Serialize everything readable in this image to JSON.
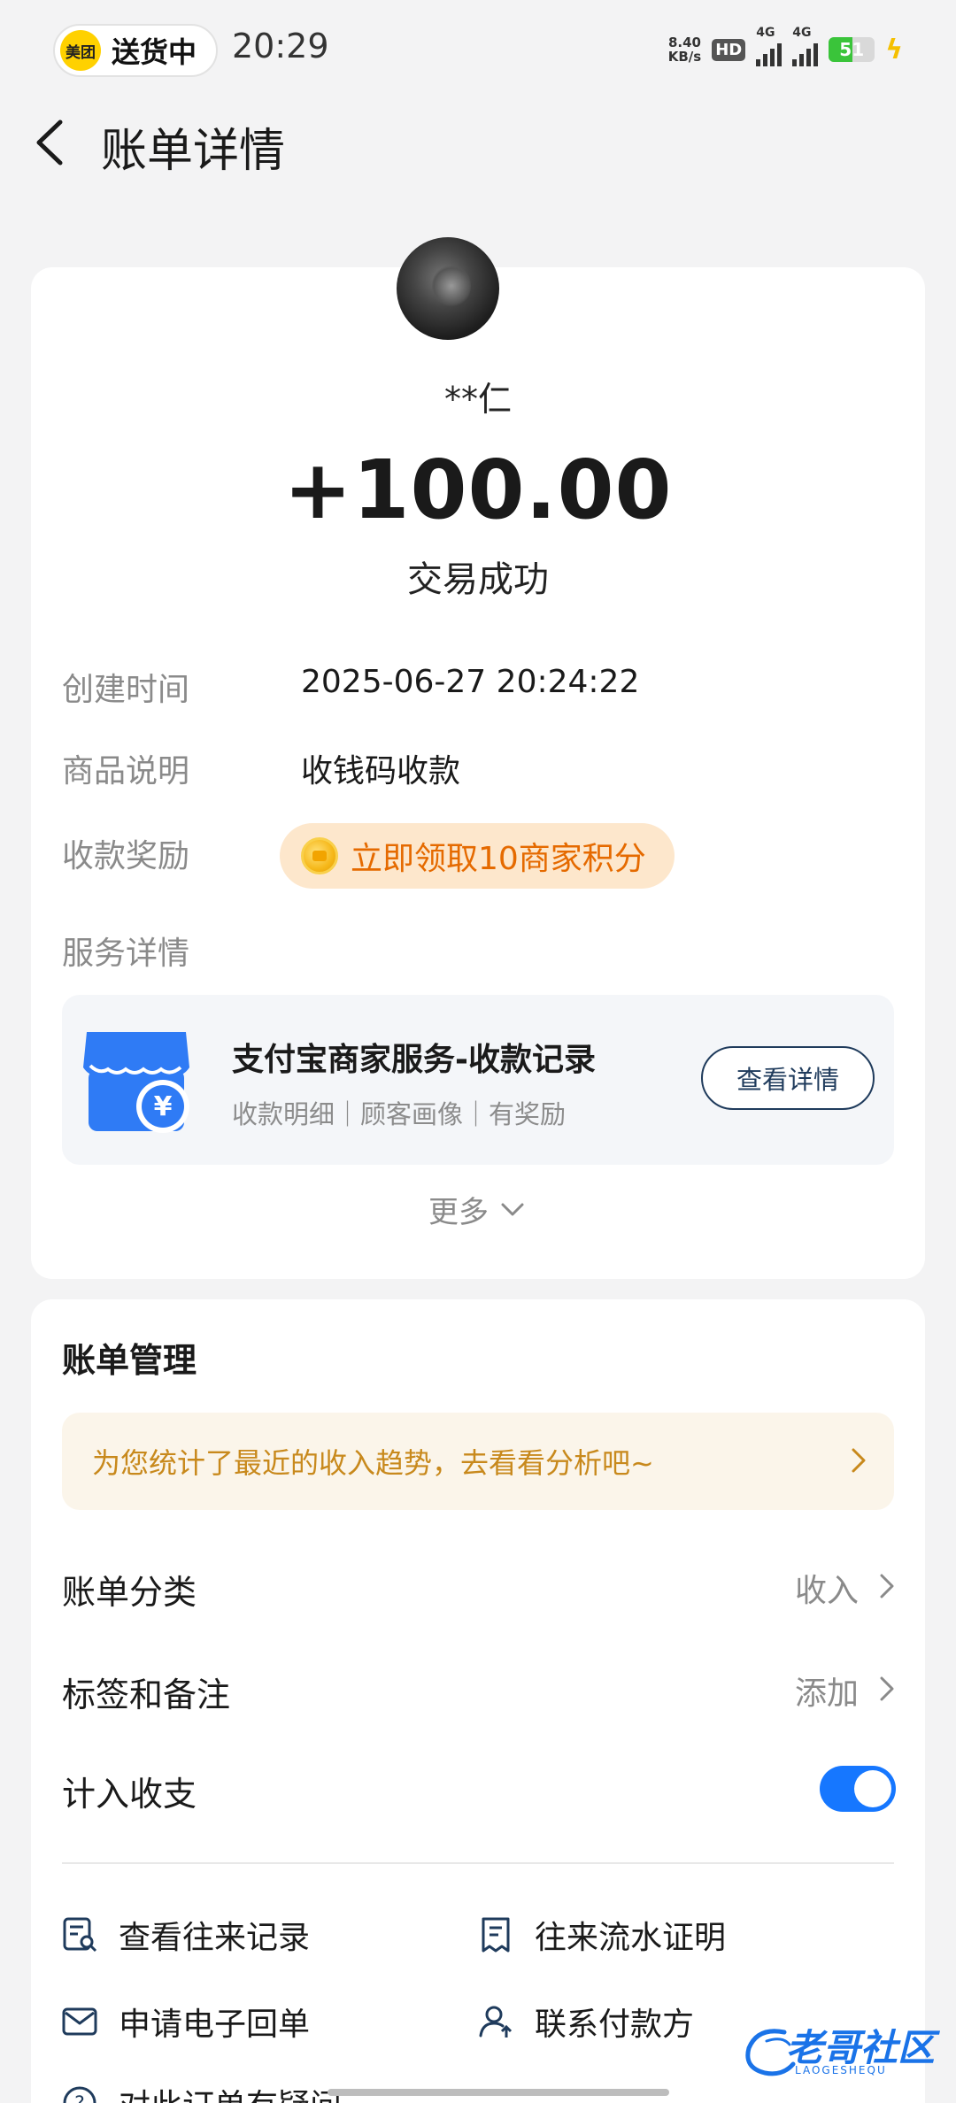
{
  "status_bar": {
    "app_pill_logo": "美团",
    "app_pill_text": "送货中",
    "time": "20:29",
    "net_speed_value": "8.40",
    "net_speed_unit": "KB/s",
    "hd_label": "HD",
    "sim1_label": "4G",
    "sim2_label": "4G",
    "battery_level": "51",
    "charging": true
  },
  "header": {
    "title": "账单详情",
    "back_icon": "chevron-left-icon"
  },
  "transaction": {
    "payer_name": "**仁",
    "amount": "+100.00",
    "status": "交易成功",
    "fields": [
      {
        "label": "创建时间",
        "value": "2025-06-27 20:24:22"
      },
      {
        "label": "商品说明",
        "value": "收钱码收款"
      }
    ],
    "reward_label": "收款奖励",
    "reward_text": "立即领取10商家积分",
    "service_label": "服务详情",
    "service": {
      "title": "支付宝商家服务-收款记录",
      "subtitle": "收款明细｜顾客画像｜有奖励",
      "button": "查看详情",
      "icon": "shop-yuan-icon"
    },
    "more_label": "更多"
  },
  "bill_management": {
    "title": "账单管理",
    "analysis_banner": "为您统计了最近的收入趋势，去看看分析吧~",
    "rows": [
      {
        "label": "账单分类",
        "value": "收入"
      },
      {
        "label": "标签和备注",
        "value": "添加"
      }
    ],
    "toggle_label": "计入收支",
    "toggle_on": true,
    "links": [
      {
        "label": "查看往来记录",
        "icon": "record-search-icon"
      },
      {
        "label": "往来流水证明",
        "icon": "document-icon"
      },
      {
        "label": "申请电子回单",
        "icon": "mail-icon"
      },
      {
        "label": "联系付款方",
        "icon": "contact-person-icon"
      },
      {
        "label": "对此订单有疑问",
        "icon": "question-icon"
      }
    ]
  },
  "watermark": {
    "text": "老哥社区",
    "sub": "LAOGESHEQU"
  },
  "colors": {
    "accent_blue": "#1677ff",
    "reward_orange": "#e56a00",
    "banner_gold": "#c8891c",
    "background": "#f3f3f4"
  }
}
